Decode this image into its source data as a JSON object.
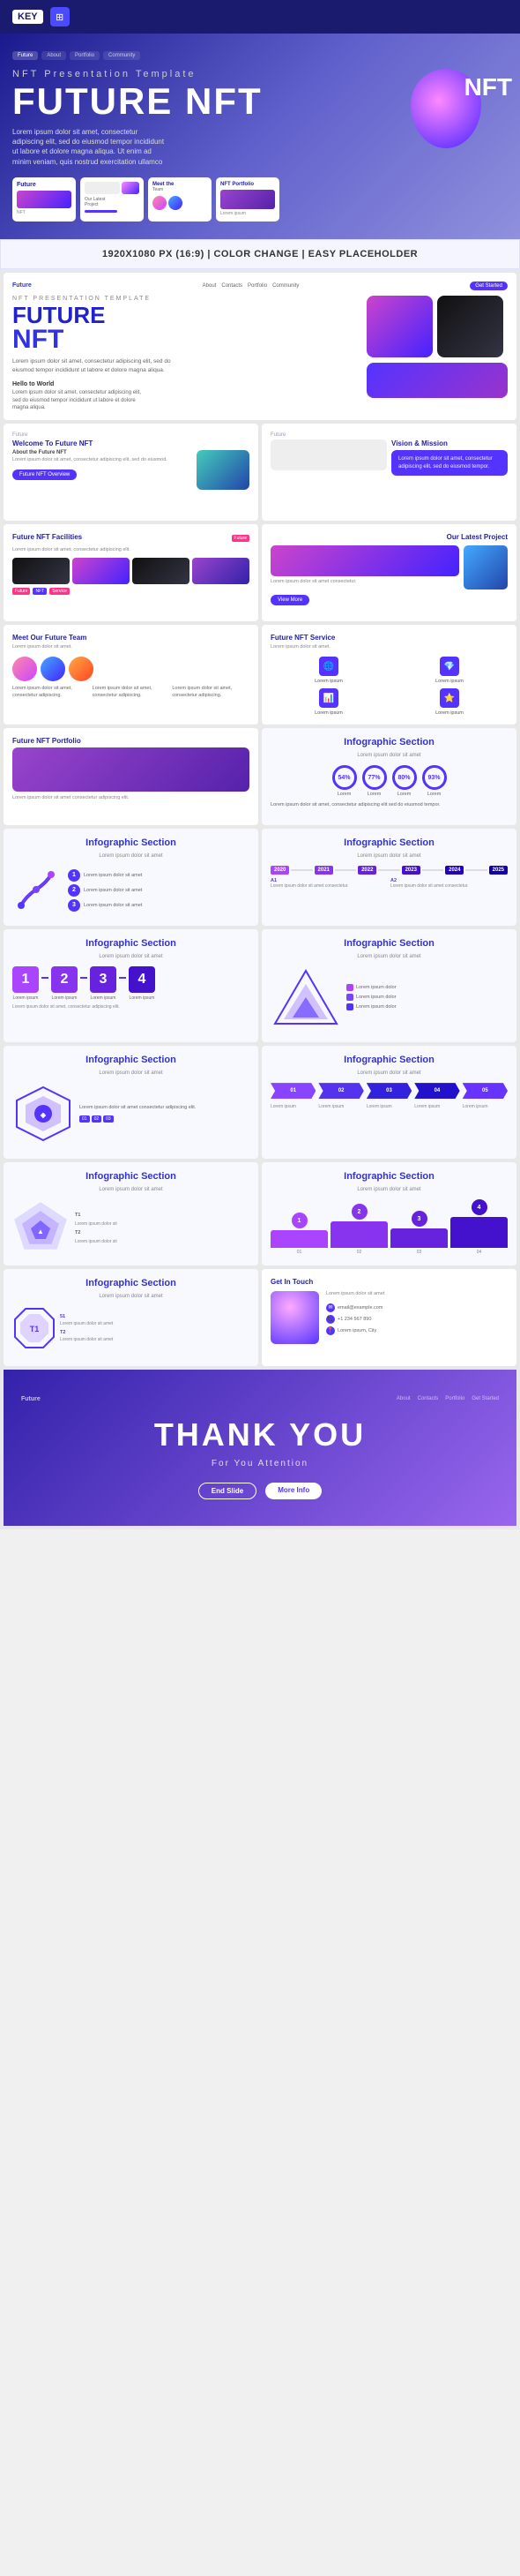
{
  "header": {
    "key_label": "KEY",
    "icon_symbol": "⊞"
  },
  "hero": {
    "title": "FUTURE NFT",
    "subtitle": "NFT Presentation Template",
    "nft_large": "NFT",
    "description": "Lorem ipsum dolor sit amet, consectetur adipiscing elit, sed do eiusmod tempor incididunt ut labore et dolore magna aliqua. Ut enim ad minim veniam, quis nostrud exercitation ullamco"
  },
  "banner": {
    "text": "1920X1080 PX (16:9) | COLOR CHANGE | EASY PLACEHOLDER"
  },
  "slides": {
    "main_slide": {
      "title": "FUTURE",
      "subtitle": "NFT PRESENTATION TEMPLATE",
      "nft": "NFT",
      "desc": "Lorem ipsum dolor sit amet, consectetur adipiscing elit, sed do eiusmod tempor incididunt ut labore et dolore magna aliqua.",
      "desc2": "Hello to World",
      "desc2_body": "Lorem ipsum dolor sit amet, consectetur adipiscing elit, sed do eiusmod tempor incididunt ut labore et dolore magna aliqua."
    },
    "welcome": {
      "label": "Welcome To Future NFT",
      "about": "About the Future NFT",
      "body": "Lorem ipsum dolor sit amet, consectetur adipiscing elit, sed do eiusmod.",
      "btn": "Future NFT Overview"
    },
    "vision": {
      "title": "Vision & Mission",
      "body": "Lorem ipsum dolor sit amet, consectetur adipiscing elit, sed do eiusmod tempor."
    },
    "facilities": {
      "title": "Future NFT Facilities",
      "body": "Lorem ipsum dolor sit amet, consectetur adipiscing elit."
    },
    "latest_project": {
      "title": "Our Latest Project",
      "body": "Lorem ipsum dolor sit amet consectetur."
    },
    "team": {
      "title": "Meet Our Future Team",
      "body": "Lorem ipsum dolor sit amet."
    },
    "service": {
      "title": "Future NFT Service",
      "body": "Lorem ipsum dolor sit amet."
    },
    "portfolio": {
      "title": "Future NFT Portfolio",
      "body": "Lorem ipsum dolor sit amet consectetur adipiscing elit."
    },
    "infographic1": {
      "title": "Infographic Section",
      "sub": "Lorem ipsum dolor sit amet"
    },
    "infographic2": {
      "title": "Infographic Section",
      "sub": "Lorem ipsum dolor sit amet"
    },
    "infographic3": {
      "title": "Infographic Section",
      "sub": "Lorem ipsum dolor sit amet"
    },
    "infographic4": {
      "title": "Infographic Section",
      "sub": "Lorem ipsum dolor sit amet"
    },
    "infographic5": {
      "title": "Infographic Section",
      "sub": "Lorem ipsum dolor sit amet"
    },
    "infographic6": {
      "title": "Infographic Section",
      "sub": "Lorem ipsum dolor sit amet"
    },
    "infographic7": {
      "title": "Infographic Section",
      "sub": "Lorem ipsum dolor sit amet"
    },
    "infographic8": {
      "title": "Infographic Section",
      "sub": "Lorem ipsum dolor sit amet"
    },
    "infographic9": {
      "title": "Infographic Section",
      "sub": "Lorem ipsum dolor sit amet"
    },
    "infographic10": {
      "title": "Infographic Section",
      "sub": "Lorem ipsum dolor sit amet"
    },
    "contact": {
      "title": "Get In Touch",
      "body": "Lorem ipsum dolor sit amet"
    },
    "thankyou": {
      "title": "THANK YOU",
      "subtitle": "For You Attention",
      "btn1": "End Slide",
      "btn2": "More Info"
    }
  },
  "nav": {
    "logo": "Future",
    "links": [
      "About",
      "Contacts",
      "Portfolio",
      "Community"
    ],
    "btn": "Get Started"
  },
  "percents": [
    "54%",
    "77%",
    "80%",
    "93%"
  ],
  "years": [
    "2020",
    "2021",
    "2022",
    "2023",
    "2024",
    "2025"
  ],
  "steps": [
    "01",
    "02",
    "03",
    "04"
  ],
  "colors": {
    "primary": "#5533ff",
    "secondary": "#cc44cc",
    "accent": "#ff3388",
    "dark": "#1a1a6e",
    "light": "#f8f8ff"
  }
}
